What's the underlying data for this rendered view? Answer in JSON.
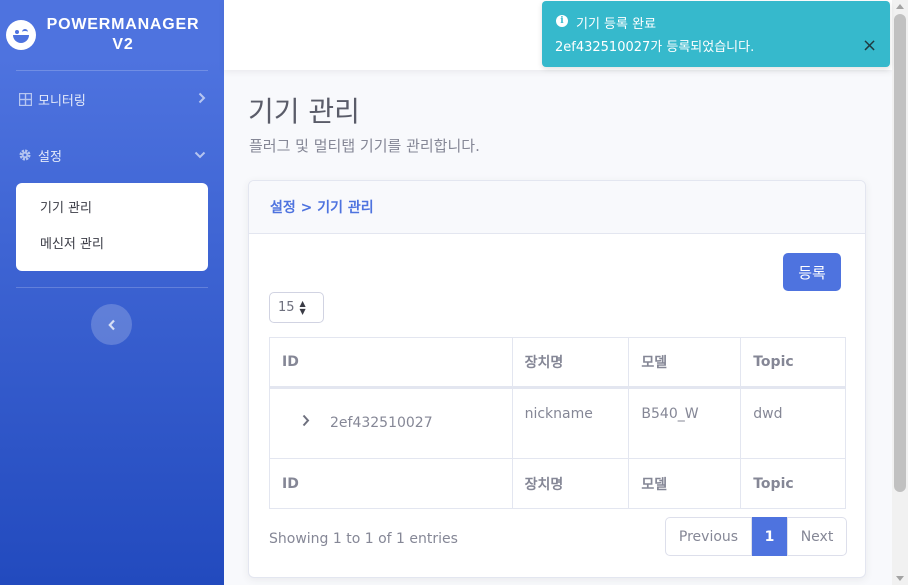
{
  "brand": {
    "line1": "POWERMANAGER",
    "line2": "V2",
    "logo_icon": "winking-face-icon"
  },
  "sidebar": {
    "items": [
      {
        "label": "모니터링",
        "icon": "grid-icon",
        "chevron": "›"
      },
      {
        "label": "설정",
        "icon": "gear-icon",
        "chevron": "⌄"
      }
    ],
    "submenu": [
      "기기 관리",
      "메신저 관리"
    ],
    "toggle_glyph": "‹"
  },
  "page": {
    "title": "기기 관리",
    "subtitle": "플러그 및 멀티탭 기기를 관리합니다."
  },
  "card": {
    "breadcrumb": "설정 > 기기 관리",
    "register_label": "등록",
    "page_length": "15",
    "columns": [
      "ID",
      "장치명",
      "모델",
      "Topic"
    ],
    "rows": [
      {
        "id": "2ef432510027",
        "name": "nickname",
        "model": "B540_W",
        "topic": "dwd"
      }
    ],
    "info": "Showing 1 to 1 of 1 entries",
    "pagination": {
      "prev": "Previous",
      "current": "1",
      "next": "Next"
    }
  },
  "toast": {
    "title": "기기 등록 완료",
    "message": "2ef432510027가 등록되었습니다.",
    "close": "×",
    "color": "#36b9cc"
  },
  "colors": {
    "primary": "#4e73df",
    "sidebar_bottom": "#224abe",
    "info": "#36b9cc"
  }
}
